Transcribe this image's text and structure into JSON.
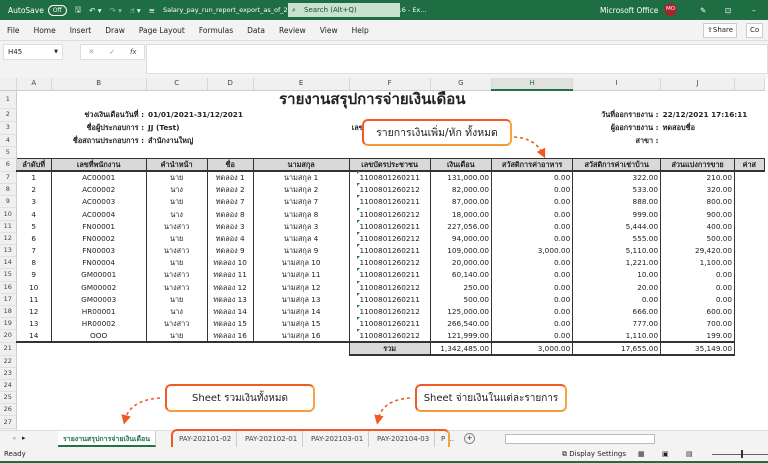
{
  "titlebar": {
    "autosave": "AutoSave",
    "autosave_state": "Off",
    "filename": "Salary_pay_run_report_export_as_of_20210101_20211231_202112221016 - Ex...",
    "search_placeholder": "Search (Alt+Q)",
    "account": "Microsoft Office",
    "avatar": "MO",
    "color": "#1f6e43"
  },
  "ribbon": {
    "tabs": [
      "File",
      "Home",
      "Insert",
      "Draw",
      "Page Layout",
      "Formulas",
      "Data",
      "Review",
      "View",
      "Help"
    ],
    "share": "Share",
    "comments": "Co"
  },
  "formula": {
    "name_box": "H45",
    "cancel": "✕",
    "enter": "✓",
    "fx": "fx",
    "value": ""
  },
  "columns": [
    "A",
    "B",
    "C",
    "D",
    "E",
    "F",
    "G",
    "H",
    "I",
    "J",
    ""
  ],
  "report": {
    "title": "รายงานสรุปการจ่ายเงินเดือน",
    "period_label": "ช่วงเงินเดือนวันที่ :",
    "period": "01/01/2021-31/12/2021",
    "company_label": "ชื่อผู้ประกอบการ :",
    "company": "JJ (Test)",
    "place_label": "ชื่อสถานประกอบการ :",
    "place": "สำนักงานใหญ่",
    "taxid_label": "เลขประจำตัวผู้เสียภาษี :",
    "office_label": "สำนักงานใหญ่ :",
    "date_label": "วันที่ออกรายงาน :",
    "date": "22/12/2021 17:16:11",
    "issuer_label": "ผู้ออกรายงาน :",
    "issuer": "ทดสอบชื่อ",
    "branch_label": "สาขา :"
  },
  "table": {
    "headers": [
      "ลำดับที่",
      "เลขที่พนักงาน",
      "คำนำหน้า",
      "ชื่อ",
      "นามสกุล",
      "เลขบัตรประชาชน",
      "เงินเดือน",
      "สวัสดิการค่าอาหาร",
      "สวัสดิการค่าเช่าบ้าน",
      "ส่วนแบ่งการขาย",
      "ค่าส"
    ],
    "rows": [
      [
        "1",
        "AC00001",
        "นาย",
        "ทดลอง 1",
        "นามสกุล 1",
        "1100801260211",
        "131,000.00",
        "0.00",
        "322.00",
        "210.00"
      ],
      [
        "2",
        "AC00002",
        "นาง",
        "ทดลอง 2",
        "นามสกุล 2",
        "1100801260212",
        "82,000.00",
        "0.00",
        "533.00",
        "320.00"
      ],
      [
        "3",
        "AC00003",
        "นาย",
        "ทดลอง 7",
        "นามสกุล 7",
        "1100801260211",
        "87,000.00",
        "0.00",
        "888.00",
        "800.00"
      ],
      [
        "4",
        "AC00004",
        "นาง",
        "ทดลอง 8",
        "นามสกุล 8",
        "1100801260212",
        "18,000.00",
        "0.00",
        "999.00",
        "900.00"
      ],
      [
        "5",
        "FN00001",
        "นางสาว",
        "ทดลอง 3",
        "นามสกุล 3",
        "1100801260211",
        "227,056.00",
        "0.00",
        "5,444.00",
        "400.00"
      ],
      [
        "6",
        "FN00002",
        "นาย",
        "ทดลอง 4",
        "นามสกุล 4",
        "1100801260212",
        "94,000.00",
        "0.00",
        "555.00",
        "500.00"
      ],
      [
        "7",
        "FN00003",
        "นางสาว",
        "ทดลอง 9",
        "นามสกุล 9",
        "1100801260211",
        "109,000.00",
        "3,000.00",
        "5,110.00",
        "29,420.00"
      ],
      [
        "8",
        "FN00004",
        "นาย",
        "ทดลอง 10",
        "นามสกุล 10",
        "1100801260212",
        "20,000.00",
        "0.00",
        "1,221.00",
        "1,100.00"
      ],
      [
        "9",
        "GM00001",
        "นางสาว",
        "ทดลอง 11",
        "นามสกุล 11",
        "1100801260211",
        "60,140.00",
        "0.00",
        "10.00",
        "0.00"
      ],
      [
        "10",
        "GM00002",
        "นางสาว",
        "ทดลอง 12",
        "นามสกุล 12",
        "1100801260212",
        "250.00",
        "0.00",
        "20.00",
        "0.00"
      ],
      [
        "11",
        "GM00003",
        "นาย",
        "ทดลอง 13",
        "นามสกุล 13",
        "1100801260211",
        "500.00",
        "0.00",
        "0.00",
        "0.00"
      ],
      [
        "12",
        "HR00001",
        "นาง",
        "ทดลอง 14",
        "นามสกุล 14",
        "1100801260212",
        "125,000.00",
        "0.00",
        "666.00",
        "600.00"
      ],
      [
        "13",
        "HR00002",
        "นางสาว",
        "ทดลอง 15",
        "นามสกุล 15",
        "1100801260211",
        "266,540.00",
        "0.00",
        "777.00",
        "700.00"
      ],
      [
        "14",
        "OOO",
        "นาย",
        "ทดลอง 16",
        "นามสกุล 16",
        "1100801260212",
        "121,999.00",
        "0.00",
        "1,110.00",
        "199.00"
      ]
    ],
    "total_label": "รวม",
    "totals": [
      "1,342,485.00",
      "3,000.00",
      "17,655.00",
      "35,149.00"
    ]
  },
  "callouts": {
    "allowances": "รายการเงินเพิ่ม/หัก ทั้งหมด",
    "summary_sheet": "Sheet รวมเงินทั้งหมด",
    "pay_sheets": "Sheet จ่ายเงินในแต่ละรายการ",
    "accent": "#f15a24"
  },
  "sheets": {
    "active": "รายงานสรุปการจ่ายเงินเดือน",
    "others": [
      "PAY-202101-02",
      "PAY-202102-01",
      "PAY-202103-01",
      "PAY-202104-03"
    ],
    "more": "P ..."
  },
  "status": {
    "ready": "Ready",
    "display_settings": "Display Settings"
  }
}
